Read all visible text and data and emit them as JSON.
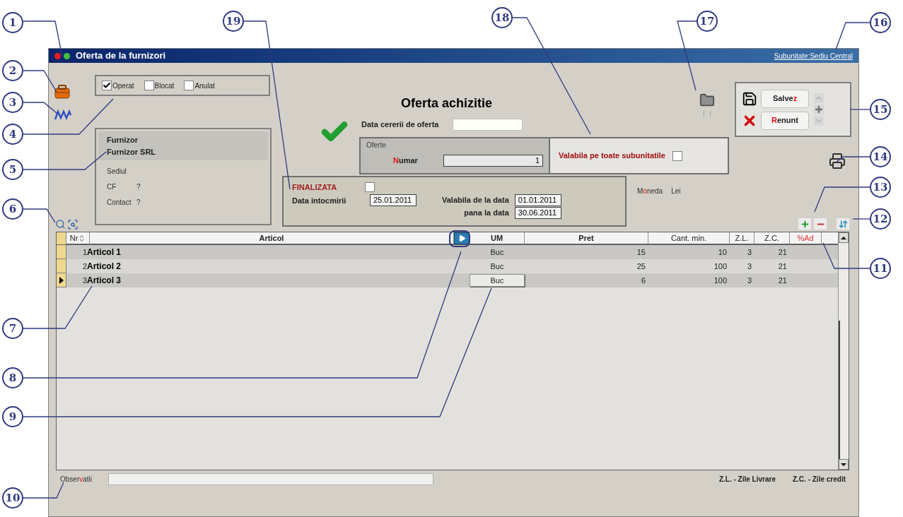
{
  "window": {
    "title": "Oferta de la furnizori",
    "subunit_link": "Subunitate:Sediu Central"
  },
  "status_checks": [
    {
      "label": "Operat",
      "checked": true
    },
    {
      "label": "Blocat",
      "checked": false
    },
    {
      "label": "Anulat",
      "checked": false
    }
  ],
  "supplier": {
    "heading": "Furnizor",
    "name": "Furnizor SRL",
    "fields": [
      {
        "label": "Sediul"
      },
      {
        "label": "CF",
        "value": "?"
      },
      {
        "label": "Contact",
        "value": "?"
      }
    ]
  },
  "document": {
    "title": "Oferta achizitie",
    "request_date_label": "Data cererii de oferta"
  },
  "offers": {
    "group_label": "Oferte",
    "number_label": [
      {
        "text": "N",
        "hotkey": true
      },
      {
        "text": "umar",
        "hotkey": false
      }
    ],
    "number": "1"
  },
  "valid_all_subunits": {
    "label": "Valabila pe toate subunitatile",
    "checked": false
  },
  "finalized": {
    "label": "FINALIZATA",
    "checked": false
  },
  "date_made": {
    "label": "Data intocmirii",
    "value": "25.01.2011"
  },
  "valid_from": {
    "label": "Valabila de la data",
    "value": "01.01.2011"
  },
  "valid_to": {
    "label": "pana la data",
    "value": "30.06.2011"
  },
  "currency": {
    "label": [
      {
        "text": "M",
        "hotkey": false
      },
      {
        "text": "o",
        "hotkey": true
      },
      {
        "text": "neda",
        "hotkey": false
      }
    ],
    "value": "Lei"
  },
  "actions": [
    {
      "kind": "save",
      "label": [
        {
          "text": "Salve",
          "hotkey": false
        },
        {
          "text": "z",
          "hotkey": true
        }
      ]
    },
    {
      "kind": "cancel",
      "label": [
        {
          "text": "R",
          "hotkey": true
        },
        {
          "text": "enunt",
          "hotkey": false
        }
      ]
    }
  ],
  "table": {
    "columns": [
      {
        "label": "Nr",
        "highlight": false
      },
      {
        "label": "Articol",
        "highlight": false
      },
      {
        "label": "UM",
        "highlight": false
      },
      {
        "label": "Pret",
        "highlight": false
      },
      {
        "label": "Cant. min.",
        "highlight": false
      },
      {
        "label": "Z.L.",
        "highlight": false
      },
      {
        "label": "Z.C.",
        "highlight": false
      },
      {
        "label": "%Ad",
        "highlight": true
      }
    ],
    "rows": [
      {
        "nr": "1",
        "articol": "Articol 1",
        "um": "Buc",
        "pret": "15",
        "cant_min": "10",
        "zl": "3",
        "zc": "21",
        "selected": false,
        "editing": false
      },
      {
        "nr": "2",
        "articol": "Articol 2",
        "um": "Buc",
        "pret": "25",
        "cant_min": "100",
        "zl": "3",
        "zc": "21",
        "selected": false,
        "editing": false
      },
      {
        "nr": "3",
        "articol": "Articol 3",
        "um": "Buc",
        "pret": "6",
        "cant_min": "100",
        "zl": "3",
        "zc": "21",
        "selected": true,
        "editing": true
      }
    ]
  },
  "observations": {
    "label": [
      {
        "text": "Obser",
        "hotkey": false
      },
      {
        "text": "v",
        "hotkey": true
      },
      {
        "text": "atii",
        "hotkey": false
      }
    ]
  },
  "legend": [
    "Z.L. - Zile Livrare",
    "Z.C. - Zile credit"
  ],
  "callouts": [
    "1",
    "19",
    "18",
    "17",
    "16",
    "2",
    "3",
    "15",
    "4",
    "14",
    "5",
    "13",
    "6",
    "12",
    "11",
    "7",
    "8",
    "9",
    "10"
  ]
}
